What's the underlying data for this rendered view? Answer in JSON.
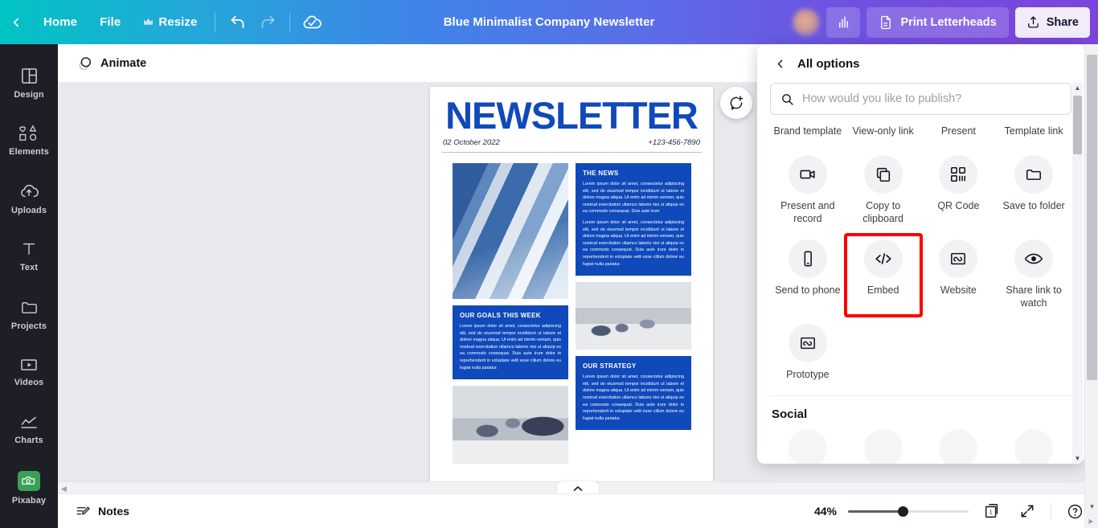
{
  "topbar": {
    "back_icon": "chevron-left-icon",
    "home_label": "Home",
    "file_label": "File",
    "resize_label": "Resize",
    "crown_icon": "crown-icon",
    "undo_icon": "undo-arrow-icon",
    "redo_icon": "redo-arrow-icon",
    "cloud_icon": "cloud-saved-icon",
    "doc_title": "Blue Minimalist Company Newsletter",
    "avatar": "user-avatar",
    "chart_icon": "bar-chart-icon",
    "print_label": "Print Letterheads",
    "print_icon": "document-icon",
    "share_label": "Share",
    "share_icon": "upload-arrow-icon",
    "accent_start": "#00c4c4",
    "accent_end": "#7b44dd"
  },
  "sidebar": {
    "items": [
      {
        "label": "Design",
        "icon": "layout-grid-icon"
      },
      {
        "label": "Elements",
        "icon": "shapes-icon"
      },
      {
        "label": "Uploads",
        "icon": "cloud-upload-icon"
      },
      {
        "label": "Text",
        "icon": "text-t-icon"
      },
      {
        "label": "Projects",
        "icon": "folder-icon"
      },
      {
        "label": "Videos",
        "icon": "video-play-icon"
      },
      {
        "label": "Charts",
        "icon": "line-chart-icon"
      },
      {
        "label": "Pixabay",
        "icon": "pixabay-camera-icon"
      }
    ],
    "pixabay_color": "#3aa056"
  },
  "subbar": {
    "animate_label": "Animate",
    "animate_icon": "animate-circles-icon"
  },
  "canvas": {
    "comment_fab_icon": "add-comment-icon",
    "newsletter": {
      "title": "NEWSLETTER",
      "date": "02 October 2022",
      "phone": "+123-456-7890",
      "title_color": "#1049ba",
      "sections": [
        {
          "heading": "THE NEWS",
          "paragraphs": [
            "Lorem ipsum dolor sit amet, consectetur adipiscing elit, sed do eiusmod tempor incididunt ut labore et dolore magna aliqua. Ut enim ad minim veniam, quis nostrud exercitation ullamco laboris nisi ut aliquip ex ea commodo consequat. Duis aute irure",
            "Lorem ipsum dolor sit amet, consectetur adipiscing elit, sed do eiusmod tempor incididunt ut labore et dolore magna aliqua. Ut enim ad minim veniam, quis nostrud exercitation ullamco laboris nisi ut aliquip ex ea commodo consequat. Duis aute irure dolor in reprehenderit in voluptate velit esse cillum dolore eu fugiat nulla pariatur."
          ]
        },
        {
          "heading": "OUR GOALS THIS WEEK",
          "paragraphs": [
            "Lorem ipsum dolor sit amet, consectetur adipiscing elit, sed do eiusmod tempor incididunt ut labore et dolore magna aliqua. Ut enim ad minim veniam, quis nostrud exercitation ullamco laboris nisi ut aliquip ex ea commodo consequat. Duis aute irure dolor in reprehenderit in voluptate velit esse cillum dolore eu fugiat nulla pariatur."
          ]
        },
        {
          "heading": "OUR STRATEGY",
          "paragraphs": [
            "Lorem ipsum dolor sit amet, consectetur adipiscing elit, sed do eiusmod tempor incididunt ut labore et dolore magna aliqua. Ut enim ad minim veniam, quis nostrud exercitation ullamco laboris nisi ut aliquip ex ea commodo consequat. Duis aute irure dolor in reprehenderit in voluptate velit esse cillum dolore eu fugiat nulla pariatur."
          ]
        }
      ],
      "photos": [
        {
          "name": "glass-office-tower-photo"
        },
        {
          "name": "team-standing-office-photo"
        },
        {
          "name": "team-meeting-presentation-photo"
        }
      ]
    }
  },
  "bottombar": {
    "notes_label": "Notes",
    "notes_icon": "notes-pencil-icon",
    "zoom_percent": "44%",
    "zoom_value": 44,
    "page_count_label": "1",
    "pages_icon": "page-stack-icon",
    "fullscreen_icon": "expand-arrows-icon",
    "help_icon": "question-circle-icon"
  },
  "share_panel": {
    "back_icon": "chevron-left-icon",
    "title": "All options",
    "search": {
      "icon": "search-icon",
      "placeholder": "How would you like to publish?",
      "value": ""
    },
    "row_partial": [
      {
        "label": "Brand template"
      },
      {
        "label": "View-only link"
      },
      {
        "label": "Present"
      },
      {
        "label": "Template link"
      }
    ],
    "options": [
      {
        "label": "Present and record",
        "icon": "video-camera-icon",
        "highlighted": false
      },
      {
        "label": "Copy to clipboard",
        "icon": "copy-icon",
        "highlighted": false
      },
      {
        "label": "QR Code",
        "icon": "qr-code-icon",
        "highlighted": false
      },
      {
        "label": "Save to folder",
        "icon": "folder-icon",
        "highlighted": false
      },
      {
        "label": "Send to phone",
        "icon": "mobile-phone-icon",
        "highlighted": false
      },
      {
        "label": "Embed",
        "icon": "code-brackets-icon",
        "highlighted": true
      },
      {
        "label": "Website",
        "icon": "website-icon",
        "highlighted": false
      },
      {
        "label": "Share link to watch",
        "icon": "eye-icon",
        "highlighted": false
      },
      {
        "label": "Prototype",
        "icon": "prototype-icon",
        "highlighted": false
      }
    ],
    "social_title": "Social",
    "highlight_color": "#ff0000"
  }
}
